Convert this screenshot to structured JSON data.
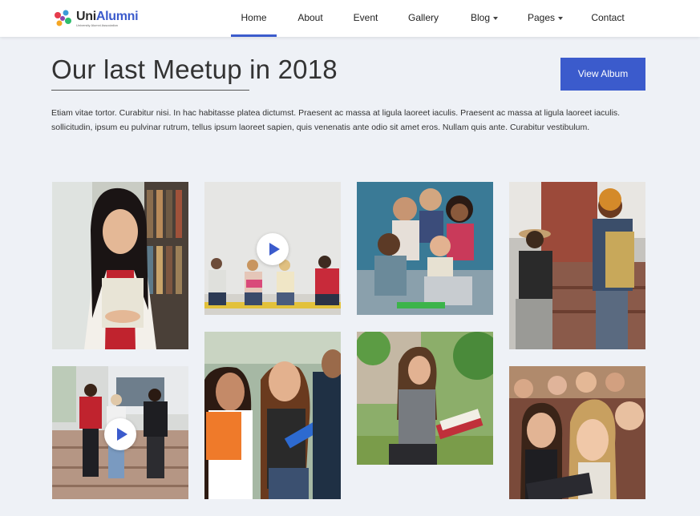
{
  "brand": {
    "name_part1": "Uni",
    "name_part2": "Alumni",
    "tagline": "University Alumni Association"
  },
  "nav": {
    "items": [
      {
        "label": "Home"
      },
      {
        "label": "About"
      },
      {
        "label": "Event"
      },
      {
        "label": "Gallery"
      },
      {
        "label": "Blog"
      },
      {
        "label": "Pages"
      },
      {
        "label": "Contact"
      }
    ]
  },
  "hero": {
    "title": "Our last Meetup in 2018",
    "button_label": "View Album",
    "description": "Etiam vitae tortor. Curabitur nisi. In hac habitasse platea dictumst. Praesent ac massa at ligula laoreet iaculis. Praesent ac massa at ligula laoreet iaculis. sollicitudin, ipsum eu pulvinar rutrum, tellus ipsum laoreet sapien, quis venenatis ante odio sit amet eros. Nullam quis ante. Curabitur vestibulum."
  },
  "colors": {
    "accent": "#3b5bcc",
    "page_background": "#eef1f6"
  },
  "gallery": {
    "items": [
      {
        "type": "photo",
        "icon": "photo-icon"
      },
      {
        "type": "video",
        "icon": "play-icon"
      },
      {
        "type": "photo",
        "icon": "photo-icon"
      },
      {
        "type": "photo",
        "icon": "photo-icon"
      },
      {
        "type": "video",
        "icon": "play-icon"
      },
      {
        "type": "photo",
        "icon": "photo-icon"
      },
      {
        "type": "photo",
        "icon": "photo-icon"
      },
      {
        "type": "photo",
        "icon": "photo-icon"
      }
    ]
  }
}
